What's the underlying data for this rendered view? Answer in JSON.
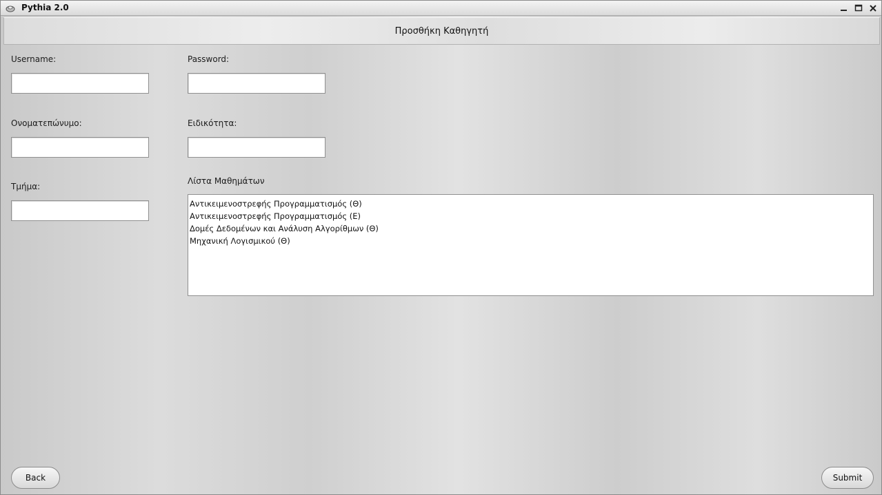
{
  "window": {
    "title": "Pythia 2.0",
    "controls": [
      "minimize-icon",
      "maximize-icon",
      "close-icon"
    ]
  },
  "header": {
    "title": "Προσθήκη Καθηγητή"
  },
  "form": {
    "username_label": "Username:",
    "username_value": "",
    "password_label": "Password:",
    "password_value": "",
    "fullname_label": "Ονοματεπώνυμο:",
    "fullname_value": "",
    "specialty_label": "Ειδικότητα:",
    "specialty_value": "",
    "department_label": "Τμήμα:",
    "department_value": "",
    "courses_label": "Λίστα Μαθημάτων",
    "courses": [
      "Αντικειμενοστρεφής Προγραμματισμός (Θ)",
      "Αντικειμενοστρεφής Προγραμματισμός (Ε)",
      "Δομές Δεδομένων και Ανάλυση Αλγορίθμων (Θ)",
      "Μηχανική Λογισμικού (Θ)"
    ]
  },
  "buttons": {
    "back": "Back",
    "submit": "Submit"
  },
  "colors": {
    "background": "#d6d6d6",
    "field": "#ffffff",
    "border": "#8f8f8f"
  }
}
